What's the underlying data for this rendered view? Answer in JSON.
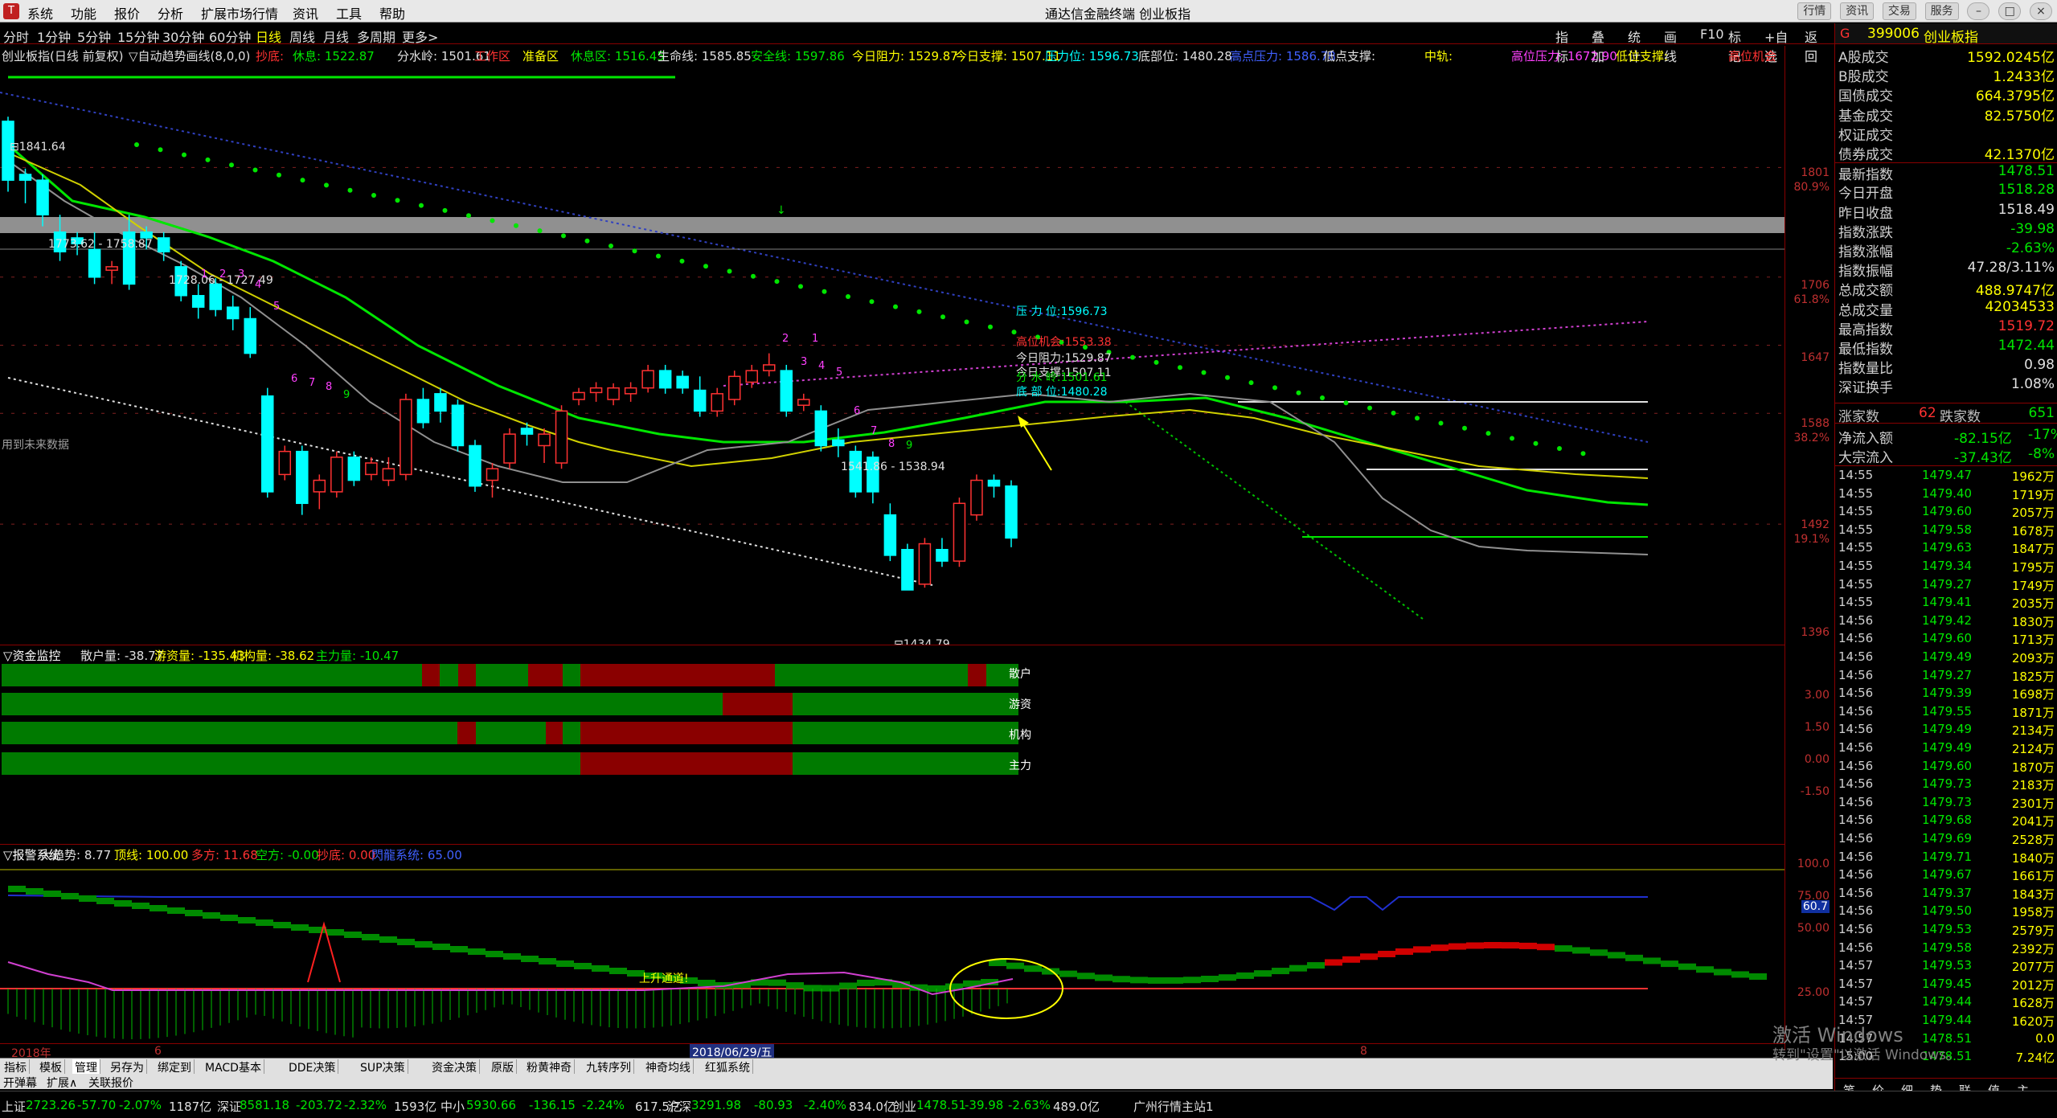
{
  "menu": {
    "items": [
      "系统",
      "功能",
      "报价",
      "分析",
      "扩展市场行情",
      "资讯",
      "工具",
      "帮助"
    ],
    "title": "通达信金融终端  创业板指"
  },
  "window_buttons": [
    "行情",
    "资讯",
    "交易",
    "服务"
  ],
  "periods": [
    "分时",
    "1分钟",
    "5分钟",
    "15分钟",
    "30分钟",
    "60分钟",
    "日线",
    "周线",
    "月线",
    "多周期",
    "更多>"
  ],
  "active_period": "日线",
  "right_tools": [
    "指标",
    "叠加",
    "统计",
    "画线",
    "F10",
    "标记",
    "+自选",
    "返回"
  ],
  "chart_info": {
    "name": "创业板指(日线 前复权)",
    "indicator": "▽自动趋势画线(8,0,0)",
    "items": [
      {
        "t": "抄底:",
        "c": "r"
      },
      {
        "t": "休息: 1522.87",
        "c": "g"
      },
      {
        "t": "分水岭: 1501.61",
        "c": "w"
      },
      {
        "t": "工作区",
        "c": "r"
      },
      {
        "t": "准备区",
        "c": "y"
      },
      {
        "t": "休息区: 1516.45",
        "c": "g"
      },
      {
        "t": "生命线: 1585.85",
        "c": "w"
      },
      {
        "t": "安全线: 1597.86",
        "c": "g"
      },
      {
        "t": "今日阻力: 1529.87",
        "c": "y"
      },
      {
        "t": "今日支撑: 1507.11",
        "c": "y"
      },
      {
        "t": "压力位: 1596.73",
        "c": "c"
      },
      {
        "t": "底部位: 1480.28",
        "c": "w"
      },
      {
        "t": "高点压力: 1586.78",
        "c": "b"
      },
      {
        "t": "低点支撑:",
        "c": "w"
      },
      {
        "t": "中轨:",
        "c": "y"
      },
      {
        "t": "高位压力: 1672.90",
        "c": "m"
      },
      {
        "t": "低位支撑:",
        "c": "y"
      }
    ],
    "right_label": "高位机会"
  },
  "price_axis": [
    "1801",
    "80.9%",
    "1706",
    "61.8%",
    "1647",
    "1588",
    "38.2%",
    "1492",
    "19.1%",
    "1396"
  ],
  "annotations": {
    "high": "1841.64",
    "range1": "1773.62 - 1758.87",
    "range2": "1728.06 - 1727.49",
    "range3": "1541.86 - 1538.94",
    "low": "1434.79",
    "sig_gaowei": "高位机会:1553.38",
    "sig_zuli": "今日阻力:1529.87",
    "sig_zhicheng": "今日支撑:1507.11",
    "sig_fenshui": "分 水 岭:1501.61",
    "sig_dibu": "底 部 位:1480.28",
    "sig_yali": "压 力 位:1596.73",
    "future_note": "用到未来数据",
    "seq1": [
      "1",
      "2",
      "3",
      "4",
      "5",
      "6",
      "7",
      "8",
      "9"
    ],
    "seq2": [
      "1",
      "2",
      "3",
      "4",
      "5",
      "6",
      "7",
      "8",
      "9"
    ]
  },
  "fund_panel": {
    "title": "▽资金监控",
    "items": [
      {
        "t": "散户量: -38.77",
        "c": "w"
      },
      {
        "t": "游资量: -135.43",
        "c": "y"
      },
      {
        "t": "机构量: -38.62",
        "c": "y"
      },
      {
        "t": "主力量: -10.47",
        "c": "g"
      }
    ],
    "rows": [
      "散户",
      "游资",
      "机构",
      "主力"
    ],
    "axis": [
      "3.00",
      "1.50",
      "0.00",
      "-1.50"
    ]
  },
  "alarm_panel": {
    "title": "▽报警系统",
    "items": [
      {
        "t": "大趋势: 8.77",
        "c": "w"
      },
      {
        "t": "顶线: 100.00",
        "c": "y"
      },
      {
        "t": "多方: 11.68",
        "c": "r"
      },
      {
        "t": "空方: -0.00",
        "c": "g"
      },
      {
        "t": "抄底: 0.00",
        "c": "r"
      },
      {
        "t": "閃龍系统: 65.00",
        "c": "b"
      }
    ],
    "axis": [
      "100.0",
      "75.00",
      "60.7",
      "50.00",
      "25.00"
    ],
    "tag": "上升通道!"
  },
  "date_axis": {
    "year": "2018年",
    "m6": "6",
    "cursor": "2018/06/29/五",
    "m8": "8"
  },
  "bottom_tabs": [
    "指标",
    "模板",
    "管理",
    "另存为",
    "绑定到",
    "MACD基本",
    "DDE决策",
    "SUP决策",
    "资金决策",
    "原版",
    "粉黄神奇",
    "九转序列",
    "神奇均线",
    "红狐系统"
  ],
  "bottom_tabs2": [
    "开弹幕",
    "扩展∧",
    "关联报价"
  ],
  "right_panel": {
    "code": "399006",
    "name": "创业板指",
    "rows": [
      {
        "k": "A股成交",
        "v": "1592.0245亿",
        "c": "y"
      },
      {
        "k": "B股成交",
        "v": "1.2433亿",
        "c": "y"
      },
      {
        "k": "国债成交",
        "v": "664.3795亿",
        "c": "y"
      },
      {
        "k": "基金成交",
        "v": "82.5750亿",
        "c": "y"
      },
      {
        "k": "权证成交",
        "v": "",
        "c": "y"
      },
      {
        "k": "债券成交",
        "v": "42.1370亿",
        "c": "y"
      },
      {
        "k": "最新指数",
        "v": "1478.51",
        "c": "g"
      },
      {
        "k": "今日开盘",
        "v": "1518.28",
        "c": "g"
      },
      {
        "k": "昨日收盘",
        "v": "1518.49",
        "c": "w"
      },
      {
        "k": "指数涨跌",
        "v": "-39.98",
        "c": "g"
      },
      {
        "k": "指数涨幅",
        "v": "-2.63%",
        "c": "g"
      },
      {
        "k": "指数振幅",
        "v": "47.28/3.11%",
        "c": "w"
      },
      {
        "k": "总成交额",
        "v": "488.9747亿",
        "c": "y"
      },
      {
        "k": "总成交量",
        "v": "42034533",
        "c": "y"
      },
      {
        "k": "最高指数",
        "v": "1519.72",
        "c": "r"
      },
      {
        "k": "最低指数",
        "v": "1472.44",
        "c": "g"
      },
      {
        "k": "指数量比",
        "v": "0.98",
        "c": "w"
      },
      {
        "k": "深证换手",
        "v": "1.08%",
        "c": "w"
      }
    ],
    "updown": {
      "up_label": "涨家数",
      "up": "62",
      "down_label": "跌家数",
      "down": "651"
    },
    "flow": [
      {
        "k": "净流入额",
        "v1": "-82.15亿",
        "v2": "-17%"
      },
      {
        "k": "大宗流入",
        "v1": "-37.43亿",
        "v2": "-8%"
      }
    ],
    "ticks": [
      [
        "14:55",
        "1479.47",
        "1962万"
      ],
      [
        "14:55",
        "1479.40",
        "1719万"
      ],
      [
        "14:55",
        "1479.60",
        "2057万"
      ],
      [
        "14:55",
        "1479.58",
        "1678万"
      ],
      [
        "14:55",
        "1479.63",
        "1847万"
      ],
      [
        "14:55",
        "1479.34",
        "1795万"
      ],
      [
        "14:55",
        "1479.27",
        "1749万"
      ],
      [
        "14:55",
        "1479.41",
        "2035万"
      ],
      [
        "14:56",
        "1479.42",
        "1830万"
      ],
      [
        "14:56",
        "1479.60",
        "1713万"
      ],
      [
        "14:56",
        "1479.49",
        "2093万"
      ],
      [
        "14:56",
        "1479.27",
        "1825万"
      ],
      [
        "14:56",
        "1479.39",
        "1698万"
      ],
      [
        "14:56",
        "1479.55",
        "1871万"
      ],
      [
        "14:56",
        "1479.49",
        "2134万"
      ],
      [
        "14:56",
        "1479.49",
        "2124万"
      ],
      [
        "14:56",
        "1479.60",
        "1870万"
      ],
      [
        "14:56",
        "1479.73",
        "2183万"
      ],
      [
        "14:56",
        "1479.73",
        "2301万"
      ],
      [
        "14:56",
        "1479.68",
        "2041万"
      ],
      [
        "14:56",
        "1479.69",
        "2528万"
      ],
      [
        "14:56",
        "1479.71",
        "1840万"
      ],
      [
        "14:56",
        "1479.67",
        "1661万"
      ],
      [
        "14:56",
        "1479.37",
        "1843万"
      ],
      [
        "14:56",
        "1479.50",
        "1958万"
      ],
      [
        "14:56",
        "1479.53",
        "2579万"
      ],
      [
        "14:56",
        "1479.58",
        "2392万"
      ],
      [
        "14:57",
        "1479.53",
        "2077万"
      ],
      [
        "14:57",
        "1479.45",
        "2012万"
      ],
      [
        "14:57",
        "1479.44",
        "1628万"
      ],
      [
        "14:57",
        "1479.44",
        "1620万"
      ],
      [
        "14:57",
        "1478.51",
        "0.0"
      ],
      [
        "15:00",
        "1478.51",
        "7.24亿"
      ]
    ],
    "foot_tabs": [
      "笔",
      "价",
      "细",
      "势",
      "联",
      "值",
      "主"
    ]
  },
  "watermark": {
    "line1": "激活 Windows",
    "line2": "转到\"设置\"以激活 Windows。"
  },
  "status": [
    {
      "t": "上证",
      "c": "w"
    },
    {
      "t": "2723.26",
      "c": "g"
    },
    {
      "t": "-57.70",
      "c": "g"
    },
    {
      "t": "-2.07%",
      "c": "g"
    },
    {
      "t": "1187亿",
      "c": "w"
    },
    {
      "t": "深证",
      "c": "w"
    },
    {
      "t": "8581.18",
      "c": "g"
    },
    {
      "t": "-203.72",
      "c": "g"
    },
    {
      "t": "-2.32%",
      "c": "g"
    },
    {
      "t": "1593亿",
      "c": "w"
    },
    {
      "t": "中小",
      "c": "w"
    },
    {
      "t": "5930.66",
      "c": "g"
    },
    {
      "t": "-136.15",
      "c": "g"
    },
    {
      "t": "-2.24%",
      "c": "g"
    },
    {
      "t": "617.5亿",
      "c": "w"
    },
    {
      "t": "沪深",
      "c": "w"
    },
    {
      "t": "3291.98",
      "c": "g"
    },
    {
      "t": "-80.93",
      "c": "g"
    },
    {
      "t": "-2.40%",
      "c": "g"
    },
    {
      "t": "834.0亿",
      "c": "w"
    },
    {
      "t": "创业",
      "c": "w"
    },
    {
      "t": "1478.51",
      "c": "g"
    },
    {
      "t": "-39.98",
      "c": "g"
    },
    {
      "t": "-2.63%",
      "c": "g"
    },
    {
      "t": "489.0亿",
      "c": "w"
    },
    {
      "t": "广州行情主站1",
      "c": "w"
    }
  ],
  "colors": {
    "up": "#ff3232",
    "down": "#00ffff",
    "green": "#00e600",
    "ma_yellow": "#ffff00",
    "axis_red": "#c03030"
  }
}
